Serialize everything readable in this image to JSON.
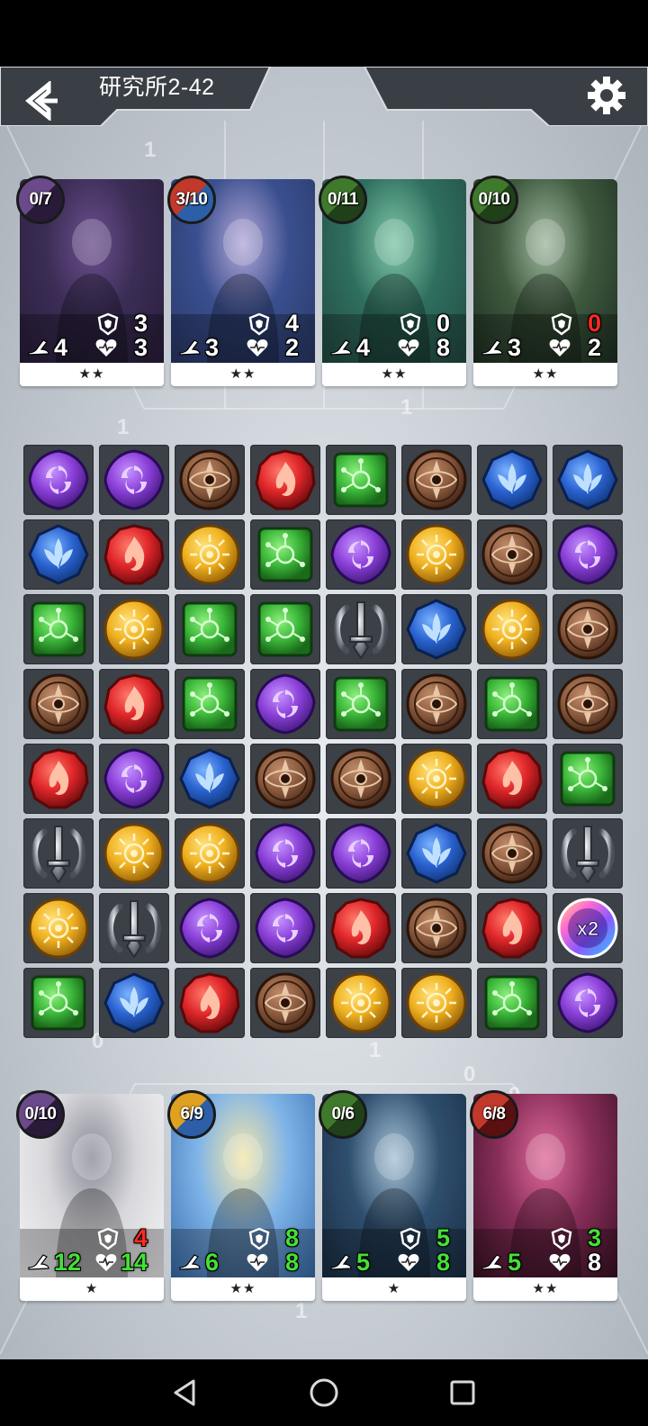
{
  "header": {
    "title": "研究所2-42",
    "back_icon": "back-arrow-icon",
    "settings_icon": "gear-icon"
  },
  "enemy_cards": [
    {
      "charge": "0/7",
      "charge_colors": [
        "#6a4a8a",
        "#2a1a3a"
      ],
      "attack": "4",
      "armor": "3",
      "health": "3",
      "armor_color": "white",
      "health_color": "white",
      "stars": "★★",
      "art": [
        "#3b2d55",
        "#6b4f8f",
        "#2a1e3c"
      ]
    },
    {
      "charge": "3/10",
      "charge_colors": [
        "#c0392b",
        "#2c5fa8"
      ],
      "attack": "3",
      "armor": "4",
      "health": "2",
      "armor_color": "white",
      "health_color": "white",
      "stars": "★★",
      "art": [
        "#3a4f8f",
        "#b4a8d8",
        "#2a3a6a"
      ]
    },
    {
      "charge": "0/11",
      "charge_colors": [
        "#3f7a2c",
        "#1f4018"
      ],
      "attack": "4",
      "armor": "0",
      "health": "8",
      "armor_color": "white",
      "health_color": "white",
      "stars": "★★",
      "art": [
        "#2f6f5f",
        "#7fc8a8",
        "#234c44"
      ]
    },
    {
      "charge": "0/10",
      "charge_colors": [
        "#3f7a2c",
        "#1f4018"
      ],
      "attack": "3",
      "armor": "0",
      "health": "2",
      "armor_color": "red",
      "health_color": "white",
      "stars": "★★",
      "art": [
        "#3f5a3f",
        "#9fb8a0",
        "#1f2f22"
      ]
    }
  ],
  "player_cards": [
    {
      "charge": "0/10",
      "charge_colors": [
        "#6a4a8a",
        "#2a1a3a"
      ],
      "attack": "12",
      "armor": "4",
      "health": "14",
      "attack_color": "green",
      "armor_color": "red",
      "health_color": "green",
      "stars": "★",
      "art": [
        "#d8d8dc",
        "#8a8a98",
        "#f4f4f6"
      ]
    },
    {
      "charge": "6/9",
      "charge_colors": [
        "#e0a020",
        "#2c5fa8"
      ],
      "attack": "6",
      "armor": "8",
      "health": "8",
      "attack_color": "green",
      "armor_color": "green",
      "health_color": "green",
      "stars": "★★",
      "art": [
        "#7fb4e8",
        "#f5e6a8",
        "#3a6fb0"
      ]
    },
    {
      "charge": "0/6",
      "charge_colors": [
        "#3f7a2c",
        "#1f4018"
      ],
      "attack": "5",
      "armor": "5",
      "health": "8",
      "attack_color": "green",
      "armor_color": "green",
      "health_color": "green",
      "stars": "★",
      "art": [
        "#2f4f6f",
        "#a8c4d8",
        "#1a2e44"
      ]
    },
    {
      "charge": "6/8",
      "charge_colors": [
        "#c0392b",
        "#5a1010"
      ],
      "attack": "5",
      "armor": "3",
      "health": "8",
      "attack_color": "green",
      "armor_color": "green",
      "health_color": "white",
      "stars": "★★",
      "art": [
        "#8a2f5a",
        "#e06a9a",
        "#3a1024"
      ]
    }
  ],
  "board": {
    "rows": [
      [
        "purple",
        "purple",
        "brown",
        "red",
        "green",
        "brown",
        "blue",
        "blue"
      ],
      [
        "blue",
        "red",
        "yellow",
        "green",
        "purple",
        "yellow",
        "brown",
        "purple"
      ],
      [
        "green",
        "yellow",
        "green",
        "green",
        "silver",
        "blue",
        "yellow",
        "brown"
      ],
      [
        "brown",
        "red",
        "green",
        "purple",
        "green",
        "brown",
        "green",
        "brown"
      ],
      [
        "red",
        "purple",
        "blue",
        "brown",
        "brown",
        "yellow",
        "red",
        "green"
      ],
      [
        "silver",
        "yellow",
        "yellow",
        "purple",
        "purple",
        "blue",
        "brown",
        "silver"
      ],
      [
        "yellow",
        "silver",
        "purple",
        "purple",
        "red",
        "brown",
        "red",
        "rainbow"
      ],
      [
        "green",
        "blue",
        "red",
        "brown",
        "yellow",
        "yellow",
        "green",
        "purple"
      ]
    ],
    "rainbow_label": "x2",
    "gem_colors": {
      "purple": {
        "base": "#8a3fd8",
        "light": "#c592ff",
        "dark": "#4a1d84",
        "icon": "swirl-icon"
      },
      "brown": {
        "base": "#8a5a3e",
        "light": "#c08a68",
        "dark": "#4a2a1a",
        "icon": "eye-icon"
      },
      "red": {
        "base": "#e0262a",
        "light": "#ff7a6a",
        "dark": "#7a0e10",
        "icon": "flame-icon"
      },
      "green": {
        "base": "#3cb83a",
        "light": "#8ef07e",
        "dark": "#1a6a1a",
        "icon": "circuit-icon"
      },
      "blue": {
        "base": "#2a62d0",
        "light": "#7ab4ff",
        "dark": "#123a80",
        "icon": "lotus-icon"
      },
      "yellow": {
        "base": "#f0b020",
        "light": "#ffe27a",
        "dark": "#a06a0a",
        "icon": "sun-icon"
      },
      "silver": {
        "base": "#9aa0a8",
        "light": "#f4f6f8",
        "dark": "#4a5058",
        "icon": "sword-icon"
      },
      "rainbow": {
        "base": "#6a4ad8",
        "light": "#ffe27a",
        "dark": "#2a62d0",
        "icon": "rainbow-multiplier-icon"
      }
    }
  },
  "nav": {
    "back_icon": "nav-back-icon",
    "home_icon": "nav-home-icon",
    "recents_icon": "nav-recents-icon"
  }
}
